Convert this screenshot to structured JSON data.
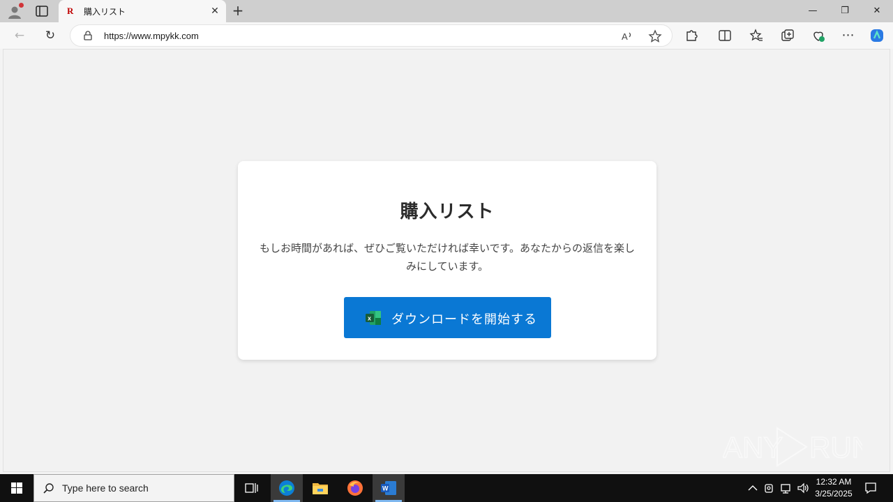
{
  "browser": {
    "tab_title": "購入リスト",
    "tab_favicon": "R",
    "tab_close": "✕",
    "new_tab": "+",
    "url": "https://www.mpykk.com",
    "window_controls": {
      "minimize": "—",
      "restore": "❐",
      "close": "✕"
    }
  },
  "page": {
    "title": "購入リスト",
    "description": "もしお時間があれば、ぜひご覧いただければ幸いです。あなたからの返信を楽しみにしています。",
    "download_button": "ダウンロードを開始する"
  },
  "watermark": "ANY RUN",
  "taskbar": {
    "search_placeholder": "Type here to search",
    "time": "12:32 AM",
    "date": "3/25/2025"
  },
  "colors": {
    "button_bg": "#0a78d4",
    "excel_green": "#21a366",
    "favicon_red": "#bf0000"
  }
}
